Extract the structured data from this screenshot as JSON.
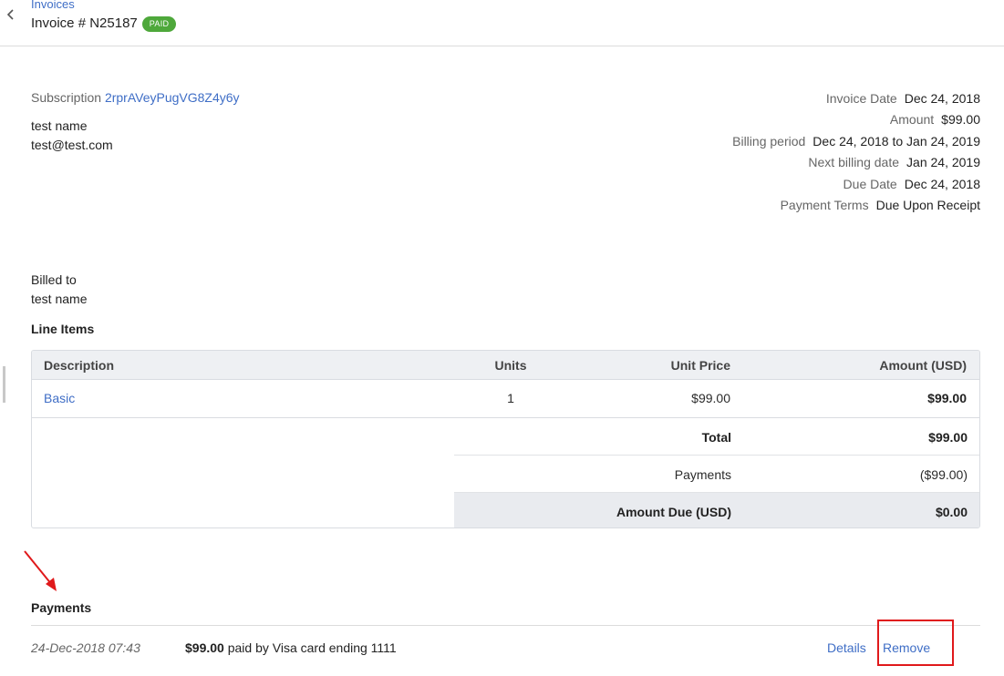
{
  "header": {
    "breadcrumb": "Invoices",
    "title": "Invoice # N25187",
    "status_badge": "PAID",
    "back_icon": "chevron-left-icon"
  },
  "subscription": {
    "label": "Subscription",
    "id": "2rprAVeyPugVG8Z4y6y"
  },
  "customer": {
    "name": "test name",
    "email": "test@test.com"
  },
  "details": [
    {
      "label": "Invoice Date",
      "value": "Dec 24, 2018"
    },
    {
      "label": "Amount",
      "value": "$99.00"
    },
    {
      "label": "Billing period",
      "value": "Dec 24, 2018 to Jan 24, 2019"
    },
    {
      "label": "Next billing date",
      "value": "Jan 24, 2019"
    },
    {
      "label": "Due Date",
      "value": "Dec 24, 2018"
    },
    {
      "label": "Payment Terms",
      "value": "Due Upon Receipt"
    }
  ],
  "billed_to": {
    "label": "Billed to",
    "name": "test name"
  },
  "line_items": {
    "title": "Line Items",
    "columns": {
      "description": "Description",
      "units": "Units",
      "unit_price": "Unit Price",
      "amount": "Amount (USD)"
    },
    "rows": [
      {
        "description": "Basic",
        "units": "1",
        "unit_price": "$99.00",
        "amount": "$99.00"
      }
    ],
    "summary": {
      "total_label": "Total",
      "total_value": "$99.00",
      "payments_label": "Payments",
      "payments_value": "($99.00)",
      "due_label": "Amount Due (USD)",
      "due_value": "$0.00"
    }
  },
  "payments": {
    "title": "Payments",
    "items": [
      {
        "date": "24-Dec-2018 07:43",
        "amount": "$99.00",
        "text": "paid by Visa card ending 1111",
        "details_label": "Details",
        "remove_label": "Remove"
      }
    ]
  },
  "colors": {
    "link": "#3f6ec6",
    "badge": "#4ea83b",
    "annotation": "#e0191b"
  }
}
